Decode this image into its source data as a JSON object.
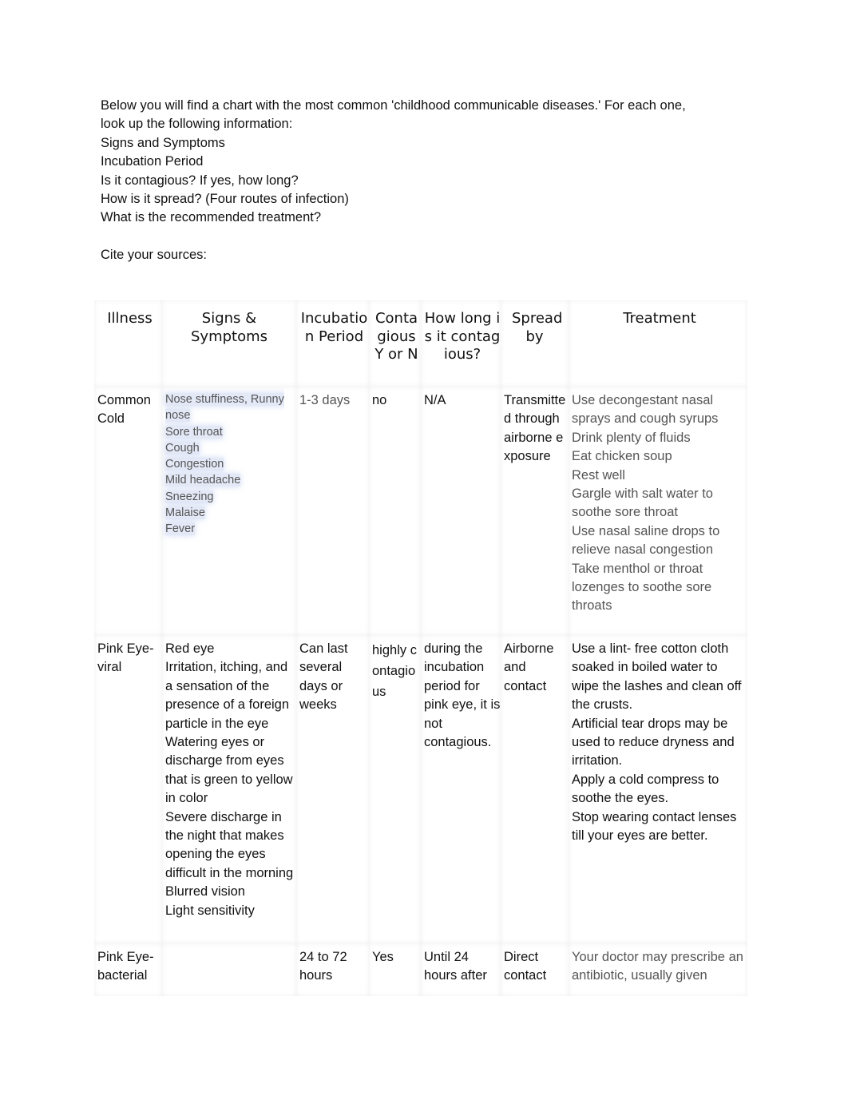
{
  "intro": {
    "lines": [
      "Below you will find a chart with the most common 'childhood communicable diseases.' For each one,",
      "look up the following information:",
      "Signs and Symptoms",
      "Incubation Period",
      "Is it contagious? If yes, how long?",
      "How is it spread? (Four routes of infection)",
      "What is the recommended treatment?"
    ],
    "cite": "Cite your sources:"
  },
  "table": {
    "headers": [
      "Illness",
      "Signs & Symptoms",
      "Incubation Period",
      "Contagious Y or N",
      "How long is it contagious?",
      "Spread by",
      "Treatment"
    ],
    "rows": [
      {
        "illness": "Common Cold",
        "symptoms": [
          "Nose stuffiness, Runny nose",
          "Sore throat",
          "Cough",
          "Congestion",
          "Mild headache",
          "Sneezing",
          "Malaise",
          "Fever"
        ],
        "incubation": "1-3 days",
        "contagious": "no",
        "how_long": "N/A",
        "spread": "Transmitted through airborne exposure",
        "treatment": [
          "Use decongestant nasal sprays and cough syrups",
          "Drink plenty of fluids",
          "Eat chicken soup",
          "Rest well",
          "Gargle with salt water to soothe sore throat",
          "Use nasal saline drops to relieve nasal congestion",
          "Take menthol or throat lozenges to soothe sore throats"
        ]
      },
      {
        "illness": "Pink Eye-viral",
        "symptoms": [
          "Red eye",
          "Irritation, itching, and a sensation of the presence of a foreign particle in the eye",
          "Watering eyes or discharge from eyes that is green to yellow in color",
          "Severe discharge in the night that makes opening the eyes difficult in the morning",
          "Blurred vision",
          "Light sensitivity"
        ],
        "incubation": "Can last several days or weeks",
        "contagious": "highly contagious",
        "how_long": "during the incubation period for pink eye, it is not contagious.",
        "spread": "Airborne and contact",
        "treatment": [
          "Use a lint- free cotton cloth soaked in boiled water to wipe the lashes and clean off the crusts.",
          "Artificial tear drops may be used to reduce dryness and irritation.",
          "Apply a cold compress to soothe the eyes.",
          "Stop wearing contact lenses till your eyes are better."
        ]
      },
      {
        "illness": "Pink Eye-bacterial",
        "symptoms": [],
        "incubation": "24 to 72 hours",
        "contagious": "Yes",
        "how_long": "Until 24 hours after",
        "spread": "Direct contact",
        "treatment": [
          "Your doctor may prescribe an antibiotic, usually given"
        ]
      }
    ]
  }
}
